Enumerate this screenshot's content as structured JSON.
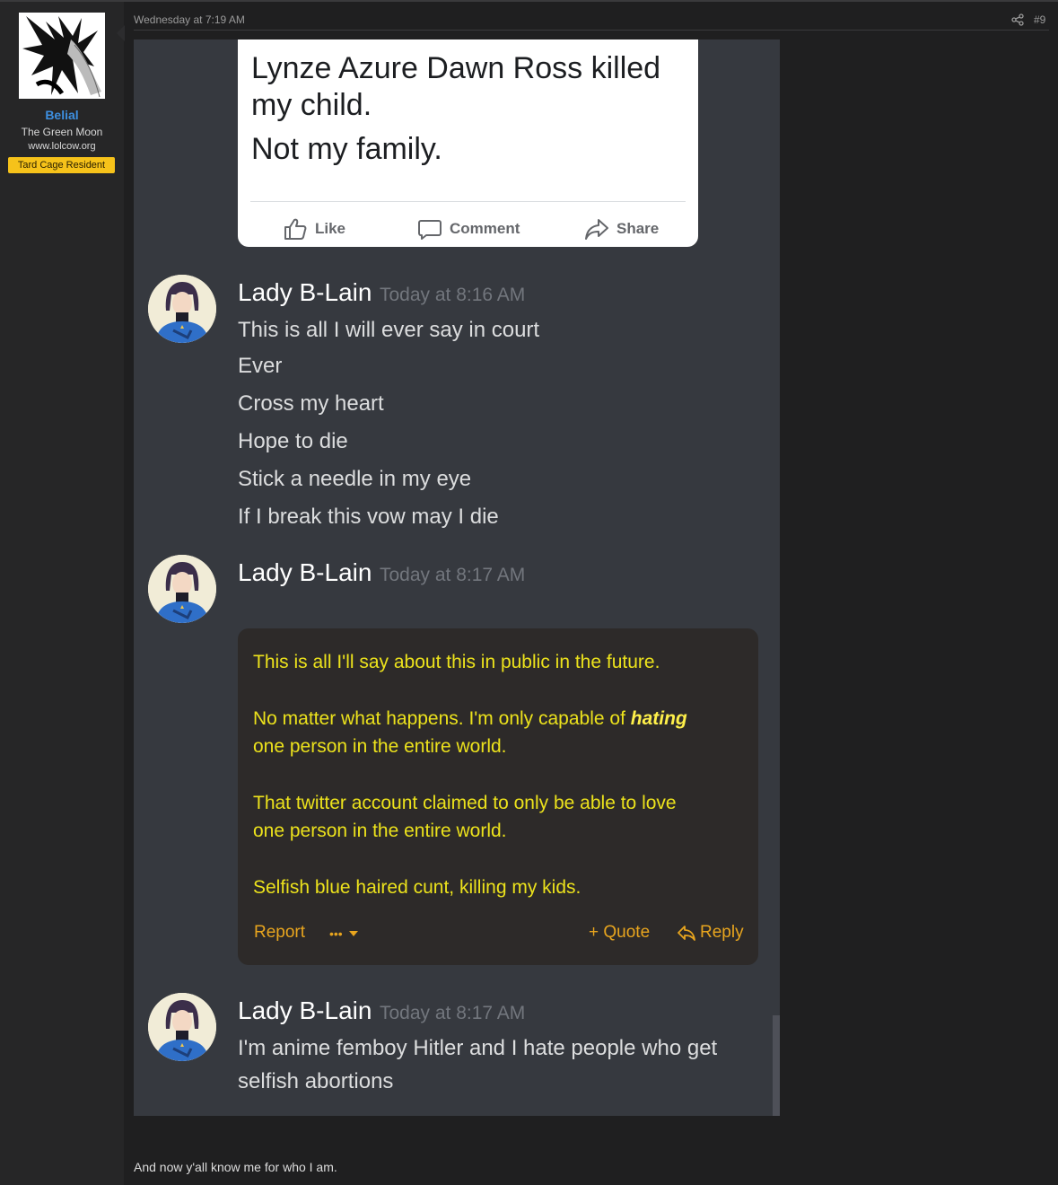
{
  "user": {
    "name": "Belial",
    "title": "The Green Moon",
    "site": "www.lolcow.org",
    "badge": "Tard Cage Resident"
  },
  "post": {
    "date": "Wednesday at 7:19 AM",
    "number": "#9",
    "footer_text": "And now y'all know me for who I am."
  },
  "fb_card": {
    "lines": [
      "Lynze Azure Dawn Ross killed",
      "my child.",
      "Not my family."
    ],
    "actions": {
      "like": "Like",
      "comment": "Comment",
      "share": "Share"
    }
  },
  "messages": [
    {
      "author": "Lady B-Lain",
      "time": "Today at 8:16 AM",
      "lines": [
        "This is all I will ever say in court",
        "Ever",
        "Cross my heart",
        "Hope to die",
        "Stick a needle in my eye",
        "If I break this vow may I die"
      ]
    },
    {
      "author": "Lady B-Lain",
      "time": "Today at 8:17 AM",
      "quote": {
        "line1": "This is all I'll say about this in public in the future.",
        "line2_before": "No matter what happens. I'm only capable of ",
        "line2_emph": "hating",
        "line3": "one person in the entire world.",
        "line4": "That twitter account claimed to only be able to love",
        "line5": "one person in the entire world.",
        "line6": "Selfish blue haired cunt, killing my kids.",
        "report": "Report",
        "more": "•••",
        "quote_btn": "+ Quote",
        "reply_btn": "Reply"
      }
    },
    {
      "author": "Lady B-Lain",
      "time": "Today at 8:17 AM",
      "lines": [
        "I'm anime femboy Hitler and I hate people who get",
        "selfish abortions"
      ]
    }
  ],
  "colors": {
    "username": "#3d8fe0",
    "badge": "#f6c21a",
    "quote_text": "#ece21c",
    "quote_actions": "#e8a51e"
  }
}
